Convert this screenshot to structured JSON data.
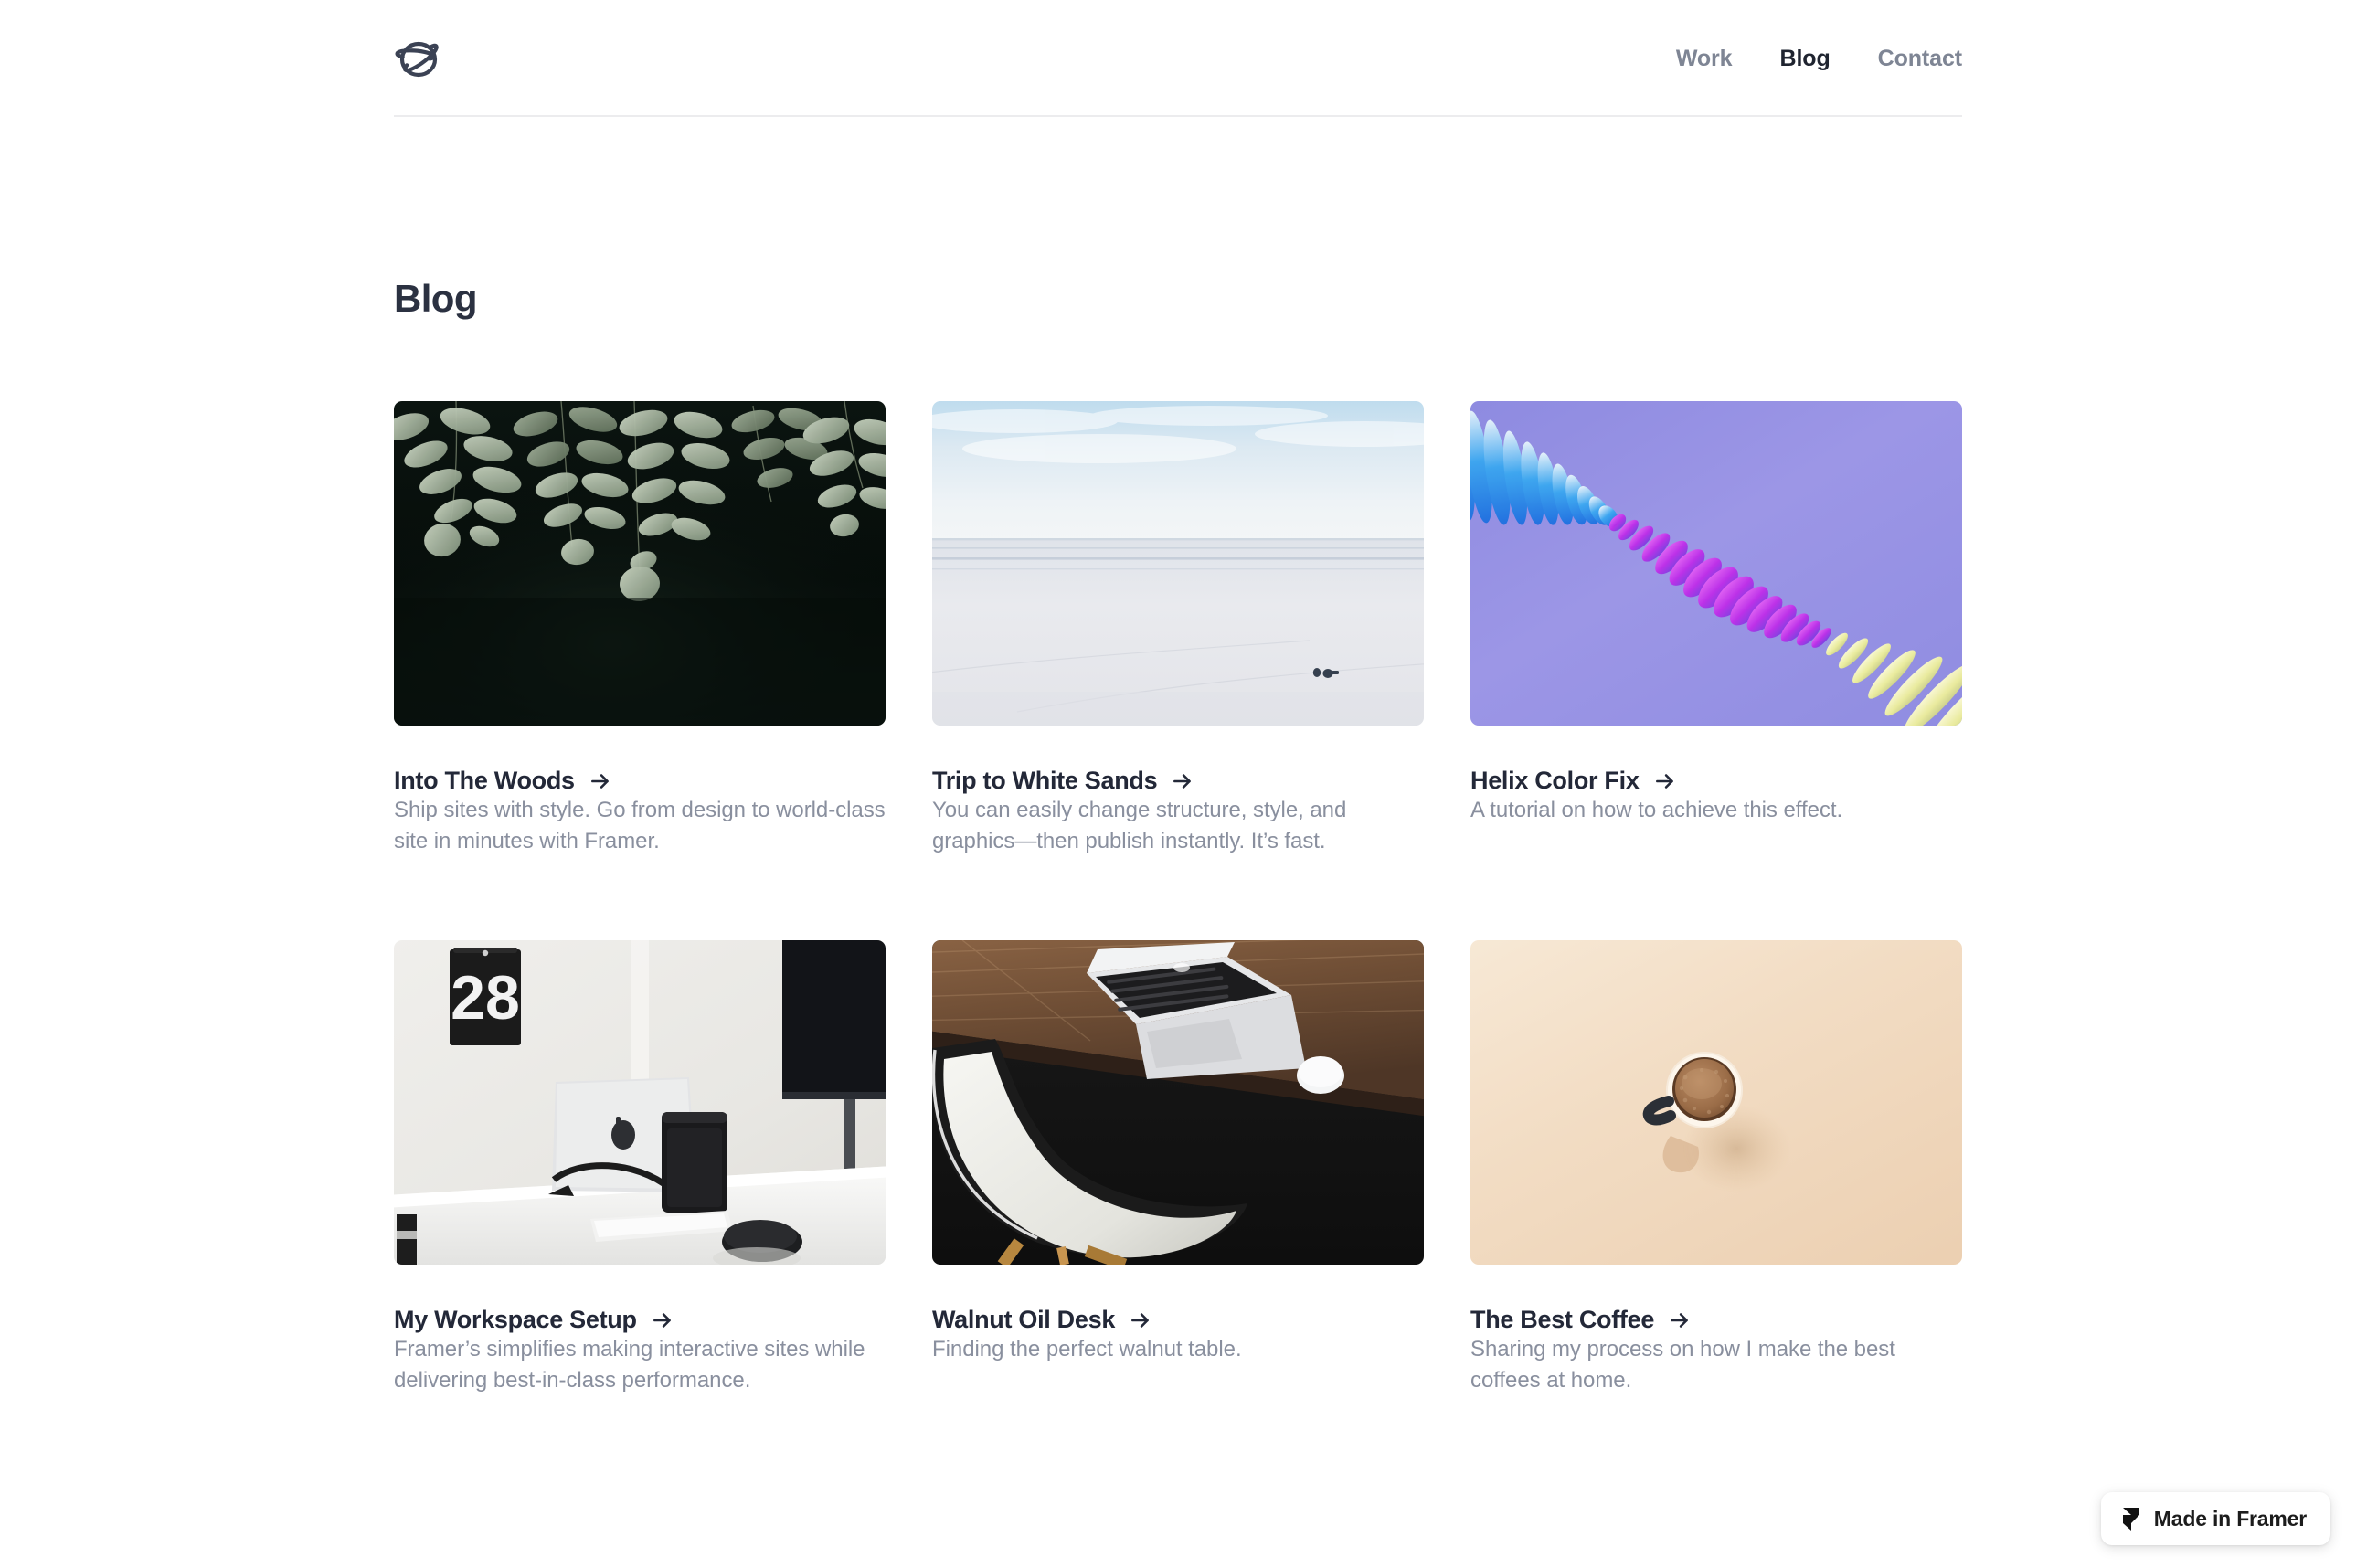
{
  "header": {
    "logo_icon": "planet-icon",
    "nav": [
      {
        "label": "Work",
        "active": false
      },
      {
        "label": "Blog",
        "active": true
      },
      {
        "label": "Contact",
        "active": false
      }
    ]
  },
  "main": {
    "page_title": "Blog",
    "posts": [
      {
        "title": "Into The Woods",
        "description": "Ship sites with style. Go from design to world-class site in minutes with Framer.",
        "arrow_icon": "arrow-right-icon",
        "thumbnail": "dark-green-leaves-photo"
      },
      {
        "title": "Trip to White Sands",
        "description": "You can easily change structure, style, and graphics—then publish instantly. It’s fast.",
        "arrow_icon": "arrow-right-icon",
        "thumbnail": "white-sands-landscape-photo"
      },
      {
        "title": "Helix Color Fix",
        "description": "A tutorial on how to achieve this effect.",
        "arrow_icon": "arrow-right-icon",
        "thumbnail": "purple-helix-gradient-render"
      },
      {
        "title": "My Workspace Setup",
        "description": "Framer’s simplifies making interactive sites while delivering best-in-class performance.",
        "arrow_icon": "arrow-right-icon",
        "thumbnail": "white-desk-workspace-photo"
      },
      {
        "title": "Walnut Oil Desk",
        "description": "Finding the perfect walnut table.",
        "arrow_icon": "arrow-right-icon",
        "thumbnail": "walnut-desk-laptop-photo"
      },
      {
        "title": "The Best Coffee",
        "description": "Sharing my process on how I make the best coffees at home.",
        "arrow_icon": "arrow-right-icon",
        "thumbnail": "coffee-cup-beige-photo"
      }
    ]
  },
  "badge": {
    "label": "Made in Framer",
    "icon": "framer-logo-icon"
  },
  "colors": {
    "text_primary": "#232838",
    "text_muted": "#898f9e",
    "nav_inactive": "#7e8594",
    "divider": "#ececee",
    "background": "#ffffff"
  }
}
